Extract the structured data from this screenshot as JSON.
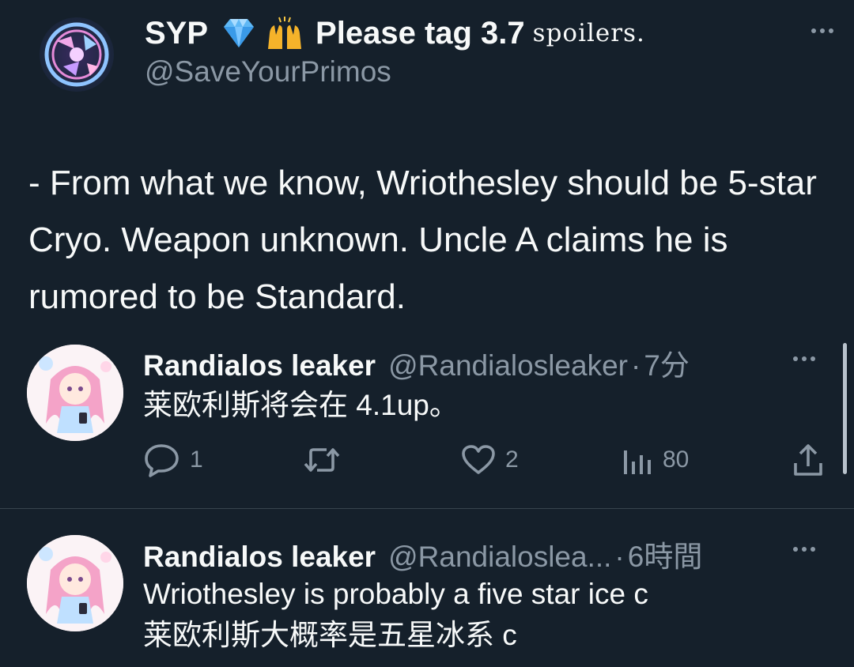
{
  "top_post": {
    "display_name": "SYP",
    "name_suffix": "Please tag 3.7",
    "name_suffix_styled": "spoilers.",
    "name_emojis": [
      "gem-emoji",
      "raising-hands-emoji"
    ],
    "handle": "@SaveYourPrimos",
    "body": "- From what we know, Wriothesley should be 5-star Cryo. Weapon unknown. Uncle A claims he is rumored to be Standard."
  },
  "replies": [
    {
      "name": "Randialos leaker",
      "handle": "@Randialosleaker",
      "dot": "·",
      "time": "7分",
      "lines": [
        "莱欧利斯将会在 4.1up。"
      ],
      "actions": {
        "reply_count": "1",
        "retweet_count": "",
        "like_count": "2",
        "view_count": "80"
      }
    },
    {
      "name": "Randialos leaker",
      "handle": "@Randialoslea...",
      "dot": "·",
      "time": "6時間",
      "lines": [
        "Wriothesley is probably a five star ice c",
        "莱欧利斯大概率是五星冰系 c"
      ]
    }
  ],
  "colors": {
    "background": "#15202b",
    "text_primary": "#f7f9f9",
    "text_secondary": "#8b98a5",
    "divider": "#38444d"
  }
}
